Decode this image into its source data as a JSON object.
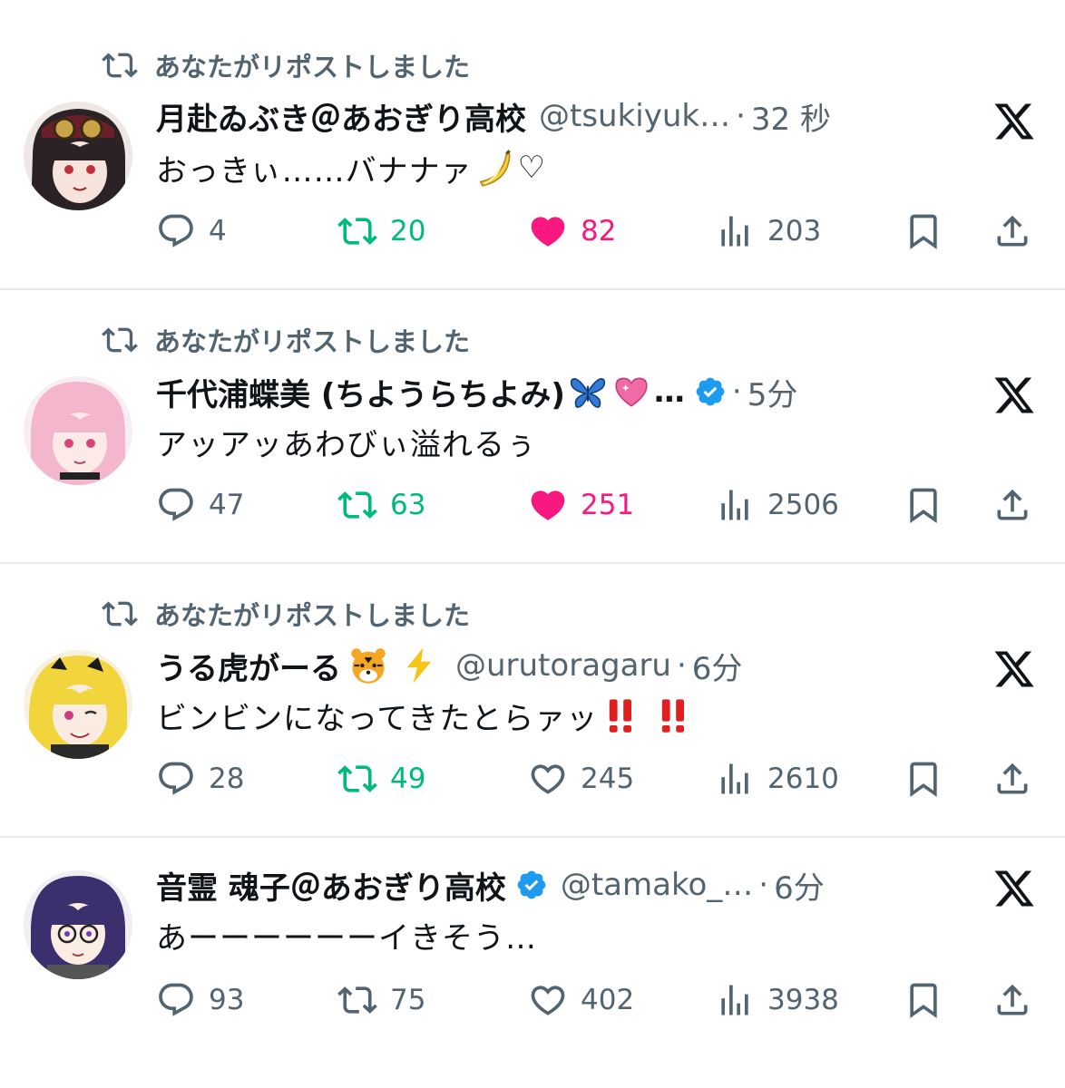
{
  "repost_label": "あなたがリポストしました",
  "posts": [
    {
      "reposted": true,
      "name": "月赴ゐぶき＠あおぎり高校",
      "handle": "@tsukiyuk…",
      "time": "32 秒",
      "text": "おっきぃ……バナナァ",
      "text_emoji": "banana",
      "text_suffix": "♡",
      "replies": "4",
      "reposts": "20",
      "likes": "82",
      "views": "203",
      "liked": true,
      "reposted_by_me": true
    },
    {
      "reposted": true,
      "name": "千代浦蝶美 (ちようらちよみ)",
      "name_emojis": [
        "butterfly",
        "sparkling-heart"
      ],
      "handle": "…",
      "verified": true,
      "time": "5分",
      "text": "アッアッあわびぃ溢れるぅ",
      "replies": "47",
      "reposts": "63",
      "likes": "251",
      "views": "2506",
      "liked": true,
      "reposted_by_me": true
    },
    {
      "reposted": true,
      "name": "うる虎がーる",
      "name_emojis": [
        "tiger-face",
        "high-voltage"
      ],
      "handle": "@urutoragaru",
      "time": "6分",
      "text": "ビンビンになってきたとらァッ",
      "text_emoji": "double-exclamation",
      "replies": "28",
      "reposts": "49",
      "likes": "245",
      "views": "2610",
      "liked": false,
      "reposted_by_me": true
    },
    {
      "reposted": false,
      "name": "音霊 魂子＠あおぎり高校",
      "verified": true,
      "handle": "@tamako_…",
      "time": "6分",
      "text": "あーーーーーーイきそう…",
      "replies": "93",
      "reposts": "75",
      "likes": "402",
      "views": "3938",
      "liked": false,
      "reposted_by_me": false
    }
  ],
  "colors": {
    "green": "#00ba7c",
    "pink": "#f91880",
    "gray": "#536471",
    "blue": "#1d9bf0"
  }
}
